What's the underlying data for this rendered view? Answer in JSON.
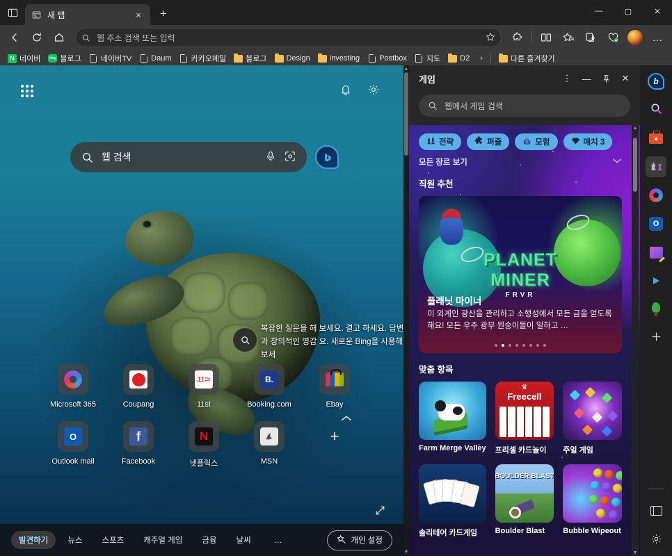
{
  "browser": {
    "tab": {
      "title": "새 탭",
      "close_label": "×",
      "favicon": "newtab-icon"
    },
    "new_tab_label": "+",
    "tab_search_label": "tab-actions-icon",
    "window_controls": {
      "minimize": "—",
      "maximize": "▢",
      "close": "✕"
    },
    "toolbar": {
      "back": "back-icon",
      "refresh": "refresh-icon",
      "home": "home-icon",
      "address_placeholder": "웹 주소 검색 또는 입력",
      "favorite_star": "star-icon",
      "extensions": "extensions-icon",
      "split_screen": "split-screen-icon",
      "favorites": "favorites-icon",
      "collections": "collections-icon",
      "browser_essentials": "browser-essentials-icon",
      "profile": "profile-avatar",
      "more": "…"
    },
    "bookmarks": [
      {
        "label": "네이버",
        "icon": "naver-icon"
      },
      {
        "label": "블로그",
        "icon": "naverblog-icon"
      },
      {
        "label": "네이버TV",
        "icon": "page-icon"
      },
      {
        "label": "Daum",
        "icon": "page-icon"
      },
      {
        "label": "카카오메일",
        "icon": "page-icon"
      },
      {
        "label": "블로그",
        "icon": "folder-icon"
      },
      {
        "label": "Design",
        "icon": "folder-icon"
      },
      {
        "label": "investing",
        "icon": "folder-icon"
      },
      {
        "label": "Postbox",
        "icon": "page-icon"
      },
      {
        "label": "지도",
        "icon": "page-icon"
      },
      {
        "label": "D2",
        "icon": "folder-icon"
      }
    ],
    "bookmarks_overflow": "›",
    "other_favorites": {
      "label": "다른 즐겨찾기",
      "icon": "folder-icon"
    }
  },
  "ntp": {
    "apps_grid_label": "app-launcher",
    "notifications_label": "notifications-icon",
    "settings_label": "settings-gear-icon",
    "search": {
      "placeholder": "웹 검색",
      "mic": "mic-icon",
      "lens": "visual-search-icon",
      "bing": "bing-chat-icon"
    },
    "promo": "복잡한 질문을 해 보세요. 결고 하세요. 답변과 창의적인 영감 요. 새로운 Bing을 사용해 보세",
    "promo_icon": "search-circle-icon",
    "collapse_icon": "chevron-up-icon",
    "expand_icon": "expand-arrows-icon",
    "shortcuts": [
      {
        "label": "Microsoft 365",
        "icon": "microsoft365-icon"
      },
      {
        "label": "Coupang",
        "icon": "coupang-icon"
      },
      {
        "label": "11st",
        "icon": "11st-icon"
      },
      {
        "label": "Booking.com",
        "icon": "booking-icon"
      },
      {
        "label": "Ebay",
        "icon": "ebay-icon"
      },
      {
        "label": "Outlook mail",
        "icon": "outlook-icon"
      },
      {
        "label": "Facebook",
        "icon": "facebook-icon"
      },
      {
        "label": "넷플릭스",
        "icon": "netflix-icon"
      },
      {
        "label": "MSN",
        "icon": "msn-icon"
      }
    ],
    "add_shortcut_label": "+",
    "feed_tabs": [
      {
        "label": "발견하기",
        "active": true
      },
      {
        "label": "뉴스",
        "active": false
      },
      {
        "label": "스포츠",
        "active": false
      },
      {
        "label": "캐주얼 게임",
        "active": false
      },
      {
        "label": "금융",
        "active": false
      },
      {
        "label": "날씨",
        "active": false
      }
    ],
    "feed_more": "…",
    "personalize": {
      "label": "개인 설정",
      "icon": "magic-star-icon"
    }
  },
  "games_panel": {
    "title": "게임",
    "header_buttons": {
      "more": "⋮",
      "minimize": "—",
      "pin": "pin-icon",
      "close": "✕"
    },
    "search_placeholder": "웹에서 게임 검색",
    "genre_chips": [
      {
        "label": "전략",
        "icon": "strategy-icon"
      },
      {
        "label": "퍼즐",
        "icon": "puzzle-icon"
      },
      {
        "label": "모험",
        "icon": "adventure-icon"
      },
      {
        "label": "매치 3",
        "icon": "gem-icon"
      }
    ],
    "all_genres": {
      "label": "모든 장르 보기",
      "icon": "chevron-down-icon"
    },
    "staff_picks_title": "직원 추천",
    "hero": {
      "logo_line1": "PLANET",
      "logo_line2": "MINER",
      "logo_line3": "FRVR",
      "name": "플래닛 마이너",
      "description": "이 외계인 광산을 관리하고 소행성에서 모든 금을 얻도록 해요! 모든 우주 광부 원숭이들이 일하고 …",
      "dots_total": 8,
      "dots_active_index": 1
    },
    "recommended_title": "맞춤 항목",
    "games": [
      {
        "label": "Farm Merge Valley",
        "thumb": "farm-merge-valley-thumb"
      },
      {
        "label": "프리셀 카드놀이",
        "thumb": "freecell-thumb"
      },
      {
        "label": "주얼 게임",
        "thumb": "jewel-thumb"
      },
      {
        "label": "솔리테어 카드게임",
        "thumb": "solitaire-thumb"
      },
      {
        "label": "Boulder Blast",
        "thumb": "boulder-blast-thumb"
      },
      {
        "label": "Bubble Wipeout",
        "thumb": "bubble-wipeout-thumb"
      }
    ]
  },
  "sidebar": {
    "items": [
      {
        "name": "bing-chat",
        "icon": "bing-icon",
        "active": false
      },
      {
        "name": "search",
        "icon": "search-icon",
        "active": false
      },
      {
        "name": "shopping",
        "icon": "shopping-briefcase-icon",
        "active": false
      },
      {
        "name": "games",
        "icon": "games-chess-icon",
        "active": true
      },
      {
        "name": "microsoft-365",
        "icon": "microsoft365-icon",
        "active": false
      },
      {
        "name": "outlook",
        "icon": "outlook-icon",
        "active": false
      },
      {
        "name": "image-creator",
        "icon": "image-editor-icon",
        "active": false
      },
      {
        "name": "drop",
        "icon": "paper-plane-icon",
        "active": false
      },
      {
        "name": "tools",
        "icon": "tree-icon",
        "active": false
      },
      {
        "name": "add",
        "icon": "plus-icon",
        "active": true
      }
    ],
    "bottom": [
      {
        "name": "toggle-sidebar",
        "icon": "panel-toggle-icon"
      },
      {
        "name": "sidebar-settings",
        "icon": "gear-icon"
      }
    ]
  },
  "colors": {
    "chrome_bg": "#202020",
    "toolbar_bg": "#393939",
    "tab_active_bg": "#393939",
    "accent_blue": "#5cb0ea",
    "panel_bg": "#272727",
    "games_gradient_start": "#2a1f68",
    "games_gradient_end": "#8b1fd0",
    "ntp_water": "#14688a"
  }
}
